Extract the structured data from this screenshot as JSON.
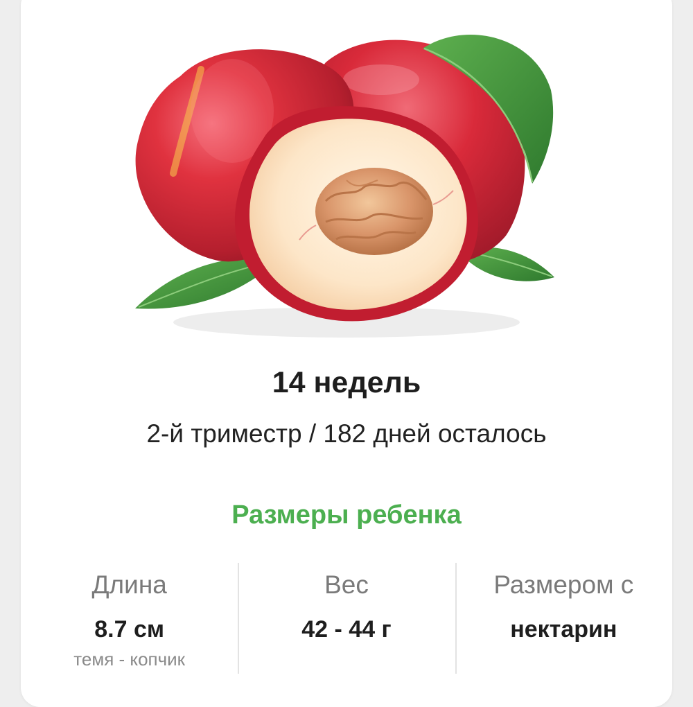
{
  "header": {
    "title": "14 недель",
    "subtitle": "2-й триместр / 182 дней осталось"
  },
  "illustration": {
    "icon": "nectarine-illustration"
  },
  "baby_size": {
    "section_title": "Размеры ребенка",
    "stats": [
      {
        "label": "Длина",
        "value": "8.7 см",
        "note": "темя - копчик"
      },
      {
        "label": "Вес",
        "value": "42 - 44 г"
      },
      {
        "label": "Размером с",
        "value": "нектарин"
      }
    ]
  },
  "colors": {
    "accent": "#4caf50",
    "fruit_red": "#d6253e",
    "flesh": "#fde5c7",
    "leaf": "#3f8f3a"
  }
}
